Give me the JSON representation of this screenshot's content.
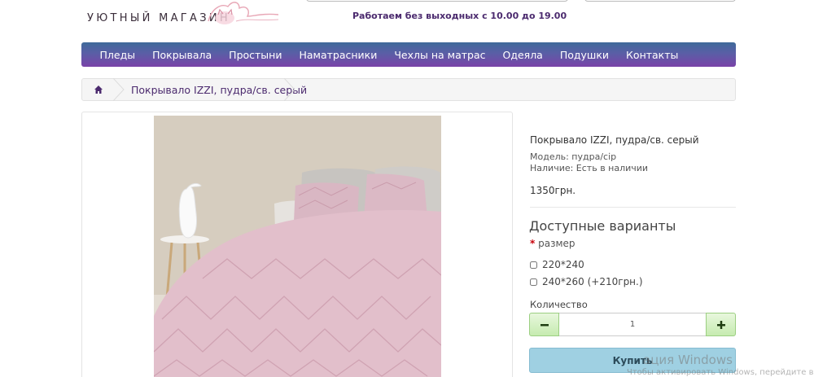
{
  "header": {
    "logo_text": "УЮТНЫЙ МАГАЗИН",
    "work_hours": "Работаем без выходных с 10.00 до 19.00"
  },
  "nav": {
    "items": [
      "Пледы",
      "Покрывала",
      "Простыни",
      "Наматрасники",
      "Чехлы на матрас",
      "Одеяла",
      "Подушки",
      "Контакты"
    ]
  },
  "breadcrumb": {
    "home_icon": "home-icon",
    "current": "Покрывало IZZI, пудра/св. серый"
  },
  "product": {
    "title": "Покрывало IZZI, пудра/св. серый",
    "model": "Модель: пудра/сір",
    "availability": "Наличие: Есть в наличии",
    "price": "1350грн."
  },
  "options": {
    "heading": "Доступные варианты",
    "required_mark": "*",
    "label": "размер",
    "choices": [
      "220*240",
      "240*260 (+210грн.)"
    ]
  },
  "quantity": {
    "label": "Количество",
    "value": "1",
    "minus_icon": "minus-icon",
    "plus_icon": "plus-icon"
  },
  "buy_button": "Купить",
  "watermark": {
    "title": "ация Windows",
    "subtitle": "Чтобы активировать Windows, перейдите в разде"
  },
  "colors": {
    "nav_top": "#3f6a9a",
    "nav_bottom": "#7a43a8",
    "accent_text": "#4b2a6e",
    "qty_button": "#c6ebb0",
    "buy_button": "#9fd0e2"
  }
}
